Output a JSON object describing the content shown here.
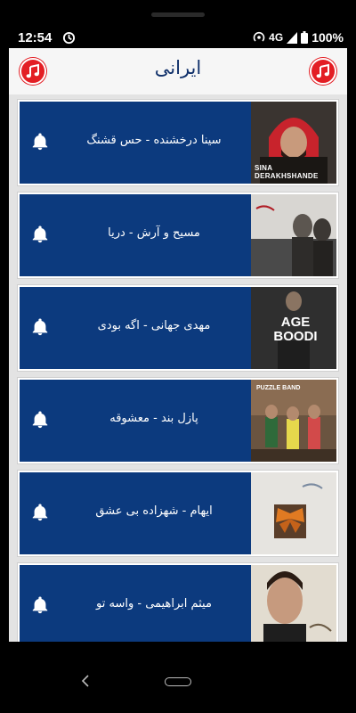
{
  "status_bar": {
    "time": "12:54",
    "network": "4G",
    "battery": "100%"
  },
  "header": {
    "title": "ایرانی",
    "left_icon": "music-note-icon",
    "right_icon": "music-note-icon"
  },
  "songs": [
    {
      "title": "سینا درخشنده - حس قشنگ",
      "cover_text": "SINA DERAKHSHANDE"
    },
    {
      "title": "مسیح و آرش - دریا",
      "cover_text": ""
    },
    {
      "title": "مهدی جهانی - اگه بودی",
      "cover_text": "AGE BOODI"
    },
    {
      "title": "پازل بند - معشوقه",
      "cover_text": "PUZZLE BAND"
    },
    {
      "title": "ایهام - شهزاده بی عشق",
      "cover_text": ""
    },
    {
      "title": "میثم ابراهیمی - واسه تو",
      "cover_text": ""
    }
  ],
  "colors": {
    "panel": "#0c3a7e",
    "accent": "#e31e24",
    "title": "#10306a"
  }
}
